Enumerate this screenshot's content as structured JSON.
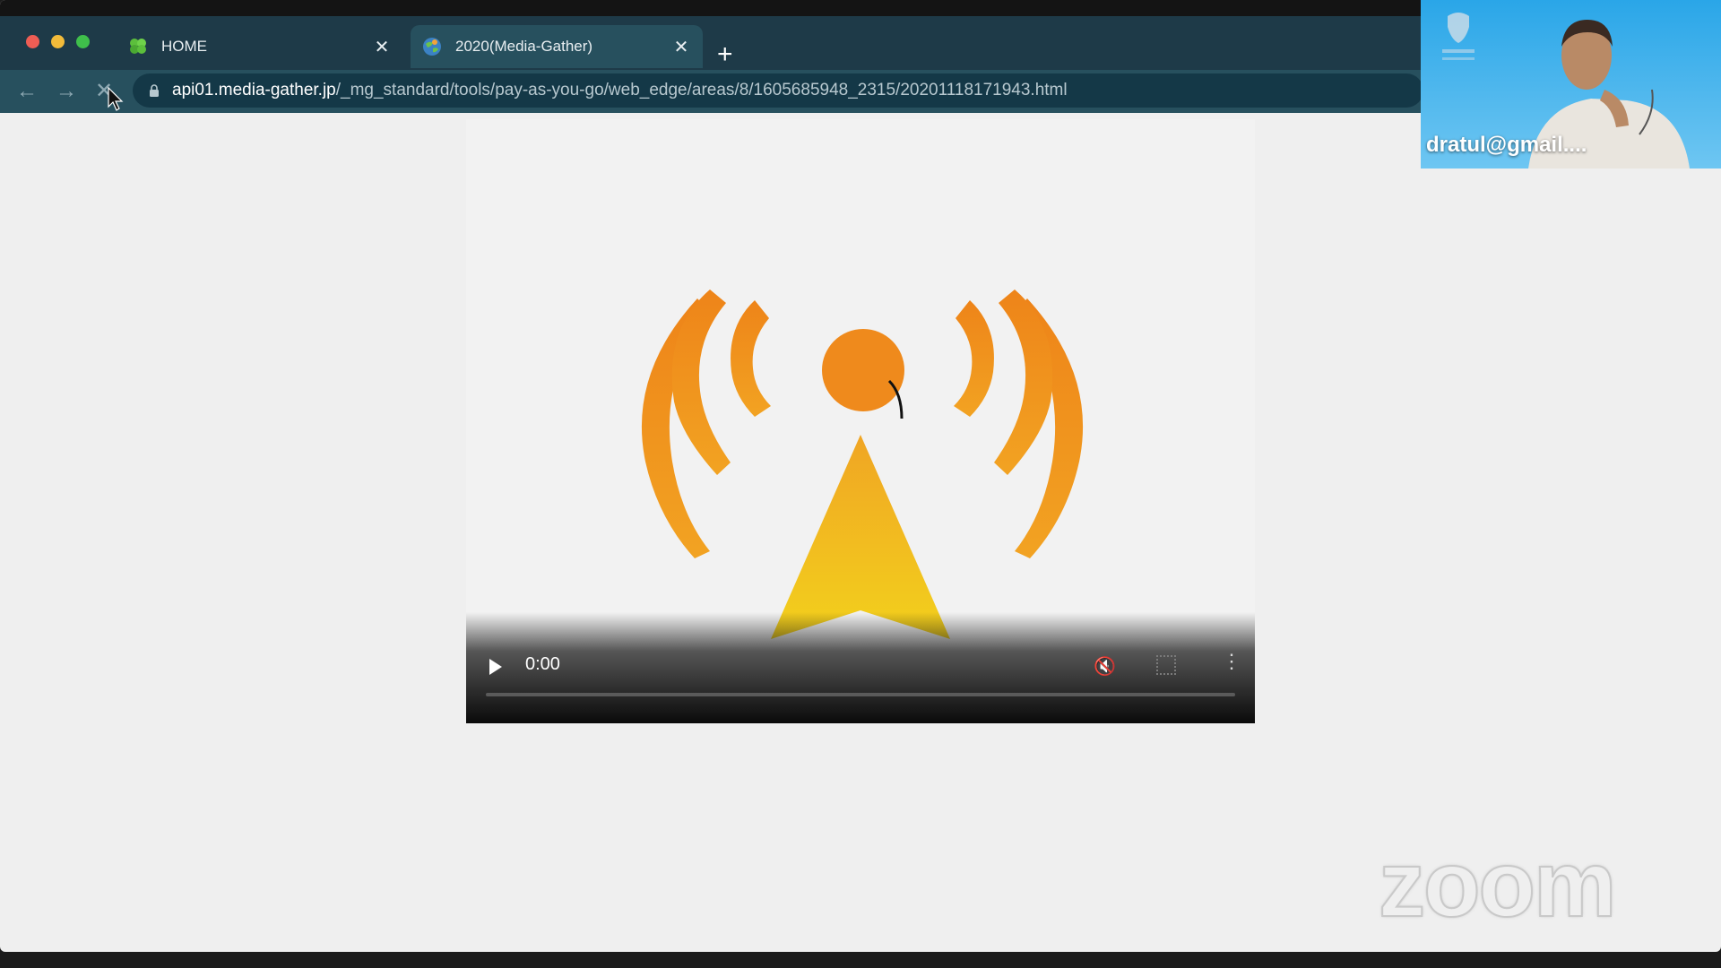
{
  "browser": {
    "tabs": [
      {
        "label": "HOME",
        "icon": "clover-icon",
        "active": false
      },
      {
        "label": "2020(Media-Gather)",
        "icon": "globe-icon",
        "active": true
      }
    ],
    "close_glyph": "✕",
    "new_tab_glyph": "+",
    "nav": {
      "back": "←",
      "forward": "→",
      "stop": "✕"
    },
    "url_host": "api01.media-gather.jp",
    "url_path": "/_mg_standard/tools/pay-as-you-go/web_edge/areas/8/1605685948_2315/20201118171943.html"
  },
  "video": {
    "time": "0:00",
    "progress": 0,
    "logo_colors": {
      "orange": "#ef8a1c",
      "yellow": "#f3c21d"
    },
    "more_glyph": "⋮",
    "volume_glyph": "🔇"
  },
  "participant": {
    "name": "dratul@gmail...."
  },
  "zoom": {
    "watermark": "zoom"
  },
  "colors": {
    "tabbar": "#1e3a48",
    "toolbar": "#27505e",
    "page_bg": "#efefef"
  }
}
